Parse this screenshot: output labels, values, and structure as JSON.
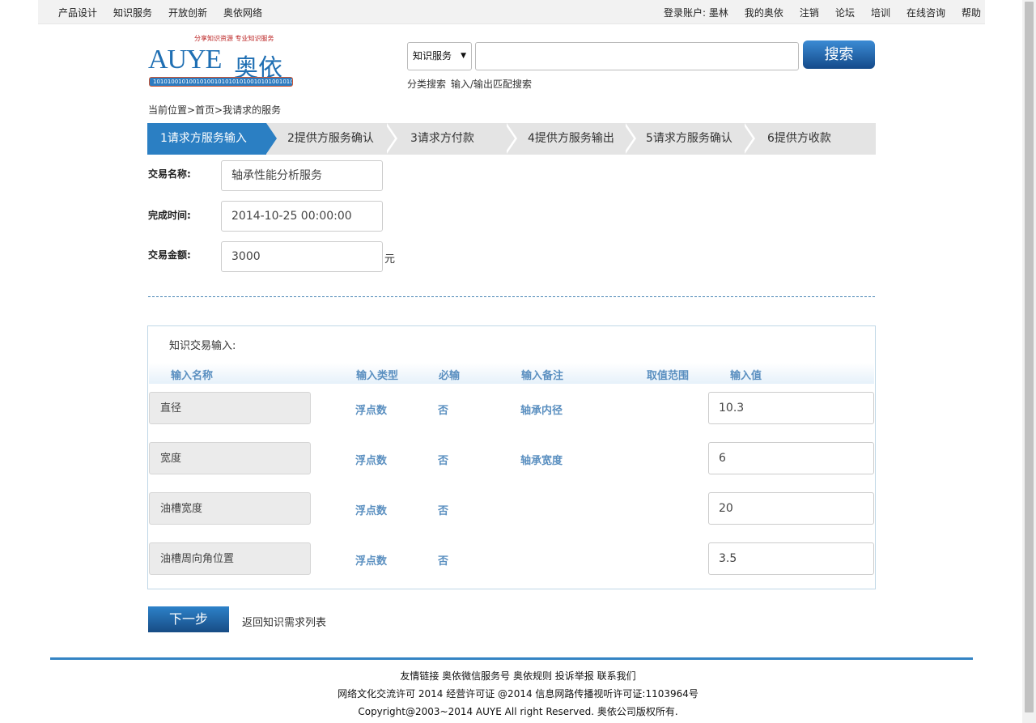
{
  "topnav": {
    "left": [
      "产品设计",
      "知识服务",
      "开放创新",
      "奥依网络"
    ],
    "right": [
      "登录账户: 墨林",
      "我的奥依",
      "注销",
      "论坛",
      "培训",
      "在线咨询",
      "帮助"
    ]
  },
  "logo": {
    "slogan": "分享知识资源 专业知识服务",
    "text": "AUYE",
    "text_cn": "奥依",
    "binary": "1010100101001010010101010100101010010101"
  },
  "search": {
    "category": "知识服务",
    "button": "搜索",
    "links": [
      "分类搜索",
      "输入/输出匹配搜索"
    ]
  },
  "breadcrumb": "当前位置>首页>我请求的服务",
  "steps": [
    "1请求方服务输入",
    "2提供方服务确认",
    "3请求方付款",
    "4提供方服务输出",
    "5请求方服务确认",
    "6提供方收款"
  ],
  "form": {
    "name_label": "交易名称:",
    "name_value": "轴承性能分析服务",
    "time_label": "完成时间:",
    "time_value": "2014-10-25 00:00:00",
    "amount_label": "交易金额:",
    "amount_value": "3000",
    "amount_unit": "元"
  },
  "panel": {
    "title": "知识交易输入:",
    "columns": [
      "输入名称",
      "输入类型",
      "必输",
      "输入备注",
      "取值范围",
      "输入值"
    ],
    "rows": [
      {
        "name": "直径",
        "type": "浮点数",
        "required": "否",
        "note": "轴承内径",
        "range": "",
        "value": "10.3"
      },
      {
        "name": "宽度",
        "type": "浮点数",
        "required": "否",
        "note": "轴承宽度",
        "range": "",
        "value": "6"
      },
      {
        "name": "油槽宽度",
        "type": "浮点数",
        "required": "否",
        "note": "",
        "range": "",
        "value": "20"
      },
      {
        "name": "油槽周向角位置",
        "type": "浮点数",
        "required": "否",
        "note": "",
        "range": "",
        "value": "3.5"
      }
    ]
  },
  "actions": {
    "next": "下一步",
    "back": "返回知识需求列表"
  },
  "footer": {
    "links": "友情链接 奥依微信服务号 奥依规则 投诉举报 联系我们",
    "license": "网络文化交流许可 2014 经营许可证 @2014 信息网路传播视听许可证:1103964号",
    "copyright": "Copyright@2003~2014 AUYE All right Reserved. 奥依公司版权所有."
  },
  "colors": {
    "accent": "#2b7fc3",
    "step_active": "#2b7fc3",
    "step_bg": "#e4e4e4"
  }
}
